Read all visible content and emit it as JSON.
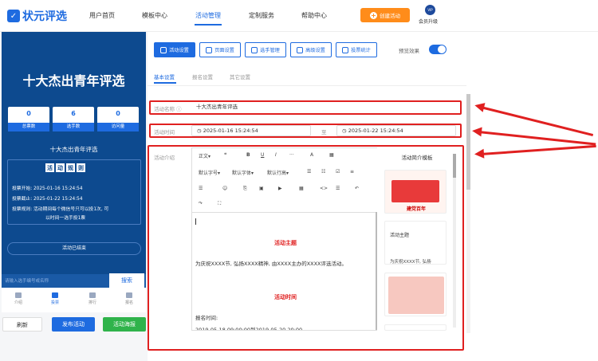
{
  "nav": {
    "logo": "状元评选",
    "items": [
      "用户首页",
      "模板中心",
      "活动管理",
      "定制服务",
      "帮助中心"
    ],
    "create": "创建活动",
    "vip_badge": "VIP",
    "vip_label": "会员升级"
  },
  "preview": {
    "title": "十大杰出青年评选",
    "stats": [
      {
        "value": "0",
        "label": "总票数"
      },
      {
        "value": "6",
        "label": "选手数"
      },
      {
        "value": "0",
        "label": "访问量"
      }
    ],
    "name": "十大杰出青年评选",
    "rules_title": [
      "活",
      "动",
      "规",
      "则"
    ],
    "rules": [
      "投票开始: 2025-01-16 15:24:54",
      "投票截止: 2025-01-22 15:24:54",
      "投票规则: 活动期间每个微信号只可以投1次, 可",
      "以时间一选手投1票"
    ],
    "ended": "活动已结束",
    "search_placeholder": "请输入选手编号或名称",
    "search_btn": "搜索",
    "tabs": [
      "介绍",
      "投票",
      "排行",
      "报名"
    ]
  },
  "actions": {
    "refresh": "刷新",
    "publish": "发布活动",
    "poster": "活动海报"
  },
  "toolbar": {
    "buttons": [
      "活动设置",
      "页面设置",
      "选手管理",
      "高级设置",
      "投票统计"
    ],
    "preview_label": "预览效果"
  },
  "subtabs": [
    "基本设置",
    "报名设置",
    "其它设置"
  ],
  "form": {
    "name_label": "活动名称",
    "name_value": "十大杰出青年评选",
    "time_label": "活动时间",
    "start": "2025-01-16 15:24:54",
    "to": "至",
    "end": "2025-01-22 15:24:54",
    "intro_label": "活动介绍"
  },
  "editor": {
    "row1": [
      "正文",
      "❝",
      "B",
      "U",
      "I",
      "···",
      "A",
      "▦"
    ],
    "row2": [
      "默认字号",
      "默认字体",
      "默认行高",
      "☰",
      "☷",
      "☑",
      "≡"
    ],
    "row3": [
      "☰",
      "☺",
      "⎘",
      "▣",
      "▶",
      "▦",
      "<>",
      "☰",
      "↶"
    ],
    "row4": [
      "↷",
      "⛶"
    ],
    "h1": "活动主题",
    "p1": "为庆祝XXXX节, 弘扬XXXX精神, 由XXXX主办的XXXX评选活动。",
    "h2": "活动时间",
    "p2": "报名时间:",
    "p3": "2019-05-18 09:00:00到2019-05-20 20:00"
  },
  "template": {
    "title": "活动简介模板",
    "card1": "建党百年",
    "card2_title": "活动主题",
    "card2_body": "为庆祝XXXX节, 弘扬"
  }
}
